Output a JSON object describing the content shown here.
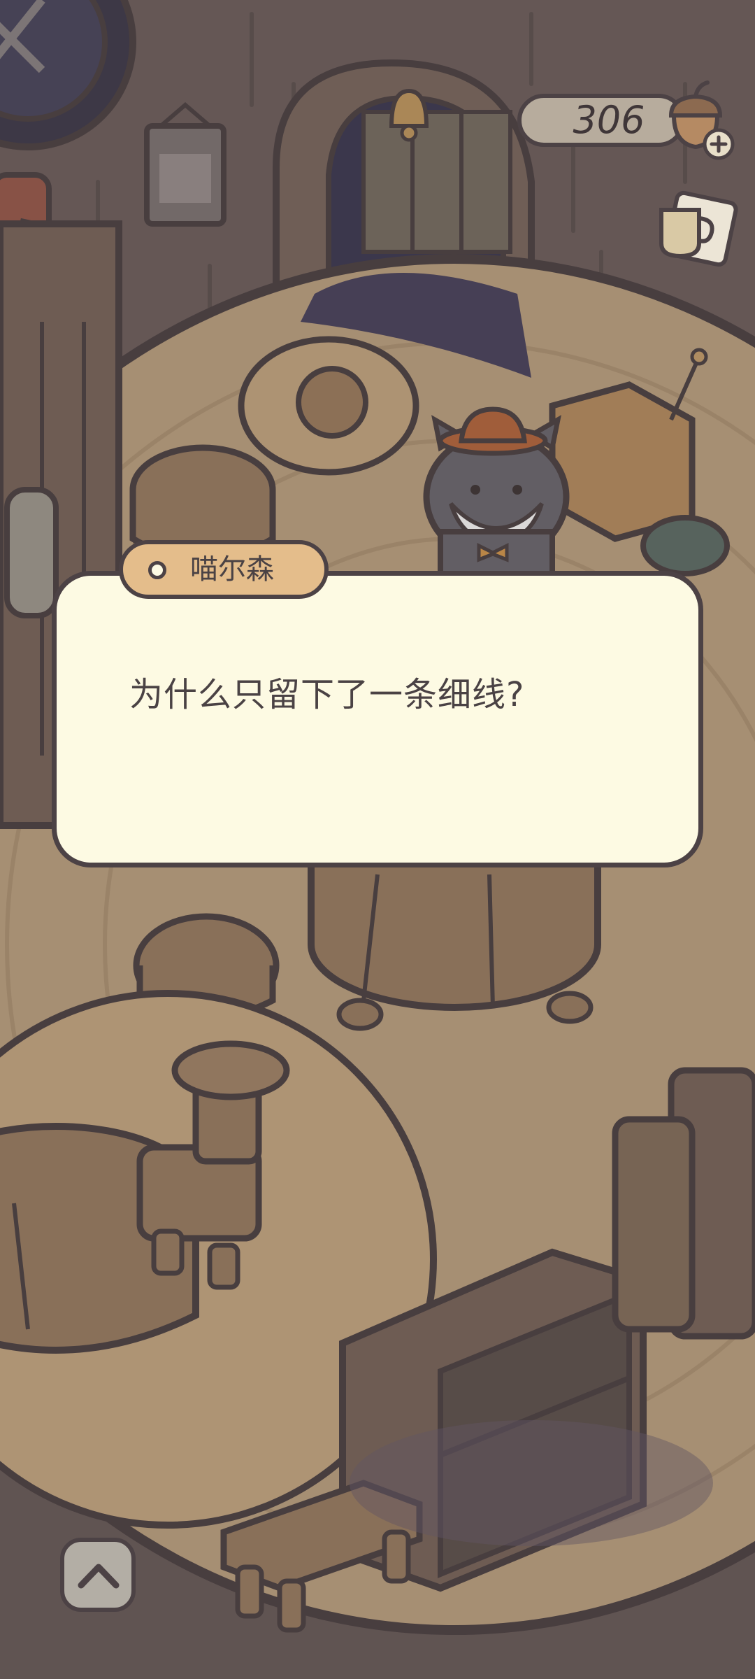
{
  "hud": {
    "currency_value": "306",
    "currency_icon": "acorn-plus-icon",
    "cup_icon": "coffee-cup-icon"
  },
  "dialog": {
    "speaker_name": "喵尔森",
    "text": "为什么只留下了一条细线?"
  },
  "controls": {
    "expand_icon": "chevron-up-icon"
  },
  "colors": {
    "outline": "#4c4245",
    "dialog_bg": "#fdfae3",
    "name_tag_bg": "#e4bd8b",
    "floor": "#bfa584"
  }
}
